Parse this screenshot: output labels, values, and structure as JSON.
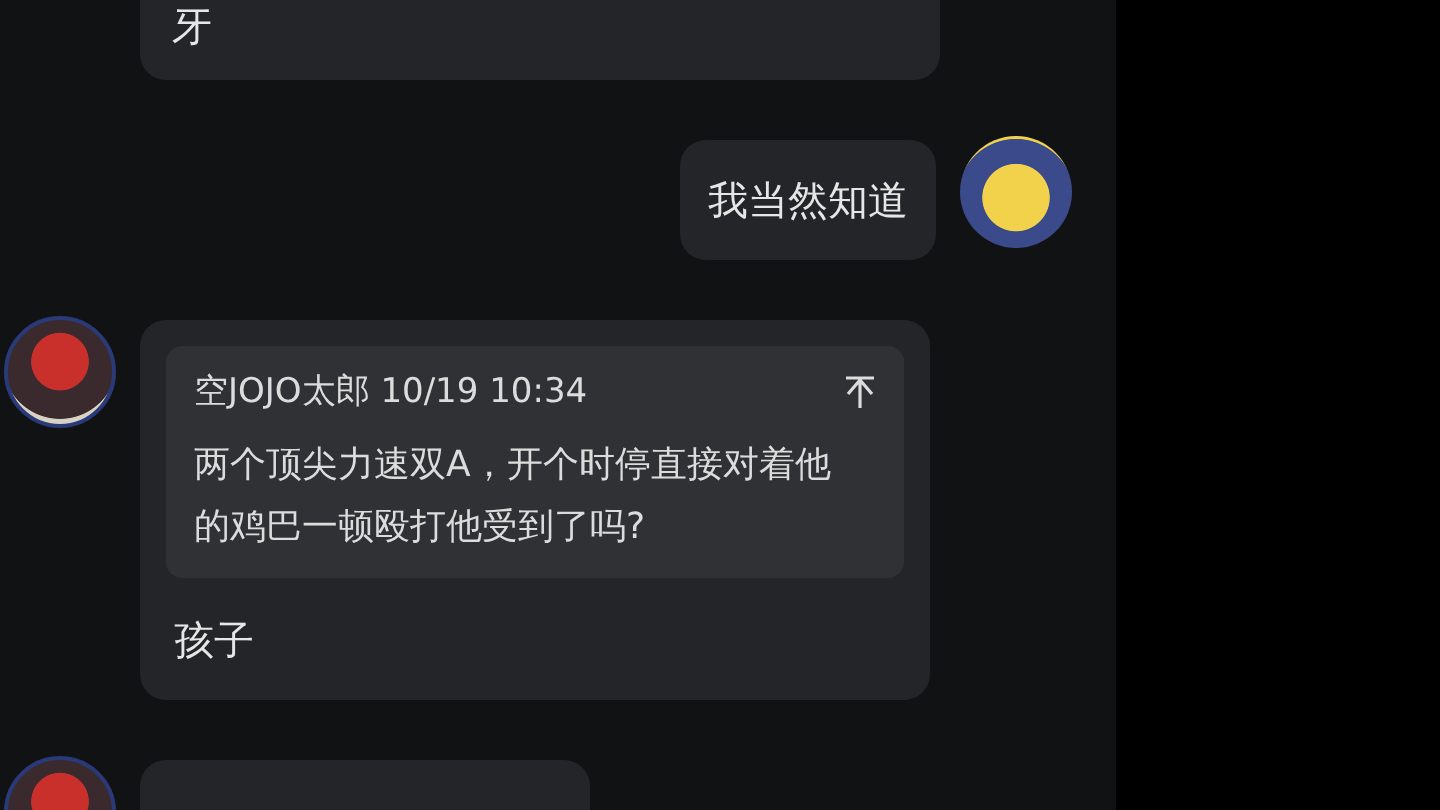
{
  "messages": [
    {
      "kind": "cut-top",
      "text": "牙"
    },
    {
      "kind": "sent",
      "avatar": true,
      "text": "我当然知道"
    },
    {
      "kind": "reply",
      "avatar": true,
      "quote": {
        "author": "空JOJO太郎",
        "time": "10/19 10:34",
        "text": "两个顶尖力速双A，开个时停直接对着他的鸡巴一顿殴打他受到了吗?"
      },
      "text": "孩子"
    },
    {
      "kind": "cut-bottom",
      "avatar": true
    }
  ]
}
